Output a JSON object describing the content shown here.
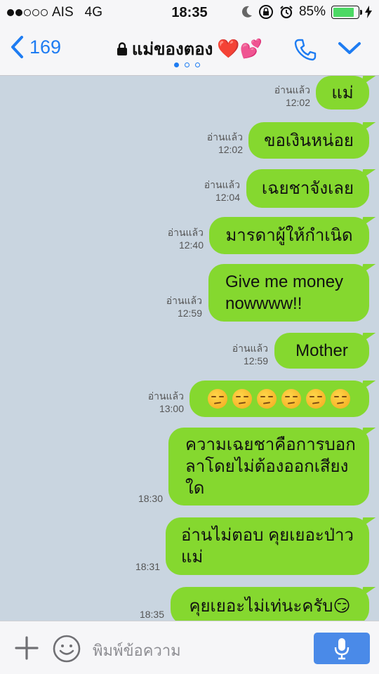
{
  "status": {
    "carrier": "AIS",
    "network": "4G",
    "time": "18:35",
    "battery": "85%",
    "battery_level": 0.85,
    "signal_bars_filled": 2,
    "signal_bars_total": 5
  },
  "nav": {
    "back_count": "169",
    "title": "แม่ของตอง",
    "title_emoji": "❤️💕",
    "page_count": 3,
    "active_page": 1
  },
  "messages": [
    {
      "text": "แม่",
      "read": "อ่านแล้ว",
      "time": "12:02"
    },
    {
      "text": "ขอเงินหน่อย",
      "read": "อ่านแล้ว",
      "time": "12:02"
    },
    {
      "text": "เฉยชาจังเลย",
      "read": "อ่านแล้ว",
      "time": "12:04"
    },
    {
      "text": "มารดาผู้ให้กำเนิด",
      "read": "อ่านแล้ว",
      "time": "12:40"
    },
    {
      "text": "Give me money nowwww!!",
      "read": "อ่านแล้ว",
      "time": "12:59"
    },
    {
      "text": "Mother",
      "read": "อ่านแล้ว",
      "time": "12:59"
    },
    {
      "text": "",
      "emoji": "unamused-face",
      "emoji_count": 6,
      "read": "อ่านแล้ว",
      "time": "13:00"
    },
    {
      "text": "ความเฉยชาคือการบอกลาโดยไม่ต้องออกเสียงใด",
      "read": "",
      "time": "18:30"
    },
    {
      "text": "อ่านไม่ตอบ คุยเยอะป่าวแม่",
      "read": "",
      "time": "18:31"
    },
    {
      "text": "คุยเยอะไม่เท่นะครับ😏",
      "read": "",
      "time": "18:35"
    }
  ],
  "input": {
    "placeholder": "พิมพ์ข้อความ"
  },
  "colors": {
    "bubble": "#85d82f",
    "accent": "#1e7cf2",
    "chat_bg": "#c9d5e0",
    "mic_button": "#4a8ae8"
  }
}
